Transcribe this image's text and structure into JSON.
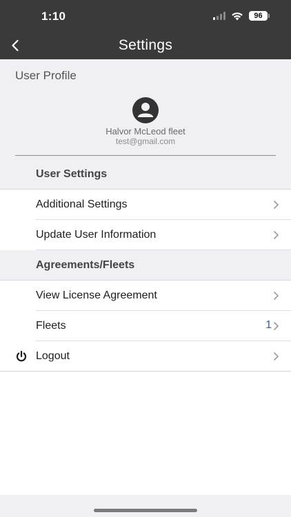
{
  "status_bar": {
    "time": "1:10",
    "battery": "96"
  },
  "header": {
    "title": "Settings",
    "back_icon": "chevron-left-icon"
  },
  "profile": {
    "heading": "User Profile",
    "name": "Halvor McLeod fleet",
    "email": "test@gmail.com",
    "avatar_icon": "person-circle-icon"
  },
  "sections": {
    "user_settings": {
      "title": "User Settings",
      "items": [
        {
          "label": "Additional Settings"
        },
        {
          "label": "Update User Information"
        }
      ]
    },
    "agreements": {
      "title": "Agreements/Fleets",
      "items": [
        {
          "label": "View License Agreement"
        },
        {
          "label": "Fleets",
          "count": "1"
        },
        {
          "label": "Logout",
          "icon": "power-icon"
        }
      ]
    }
  },
  "colors": {
    "header_bg": "#3a3a3a",
    "section_bg": "#efeff4",
    "count_text": "#2b5fa6"
  }
}
